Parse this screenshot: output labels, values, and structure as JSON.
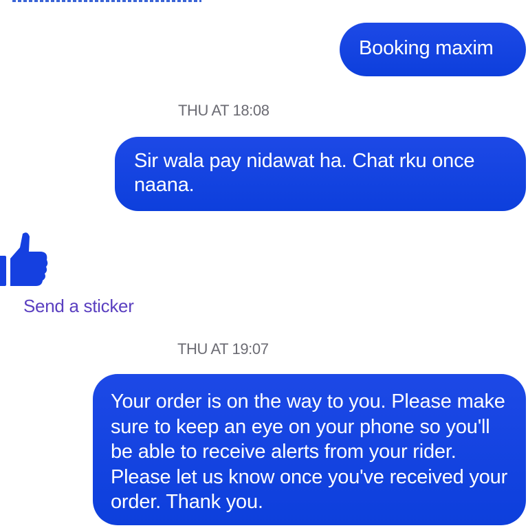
{
  "messages": [
    {
      "text": "Booking maxim"
    },
    {
      "timestamp": "THU AT 18:08"
    },
    {
      "text": "Sir wala pay nidawat ha. Chat rku once naana."
    },
    {
      "timestamp": "THU AT 19:07"
    },
    {
      "text": "Your order is on the way to you. Please make sure to keep an eye on your phone so you'll be able to receive alerts from your rider. Please let us know once you've received your order. Thank you."
    }
  ],
  "sticker": {
    "icon": "thumbs-up-icon",
    "label": "Send a sticker"
  },
  "colors": {
    "bubble": "#1a46e4",
    "timestamp": "#6b6b73",
    "sticker_label": "#5a3fc0",
    "thumb": "#1540e0"
  }
}
